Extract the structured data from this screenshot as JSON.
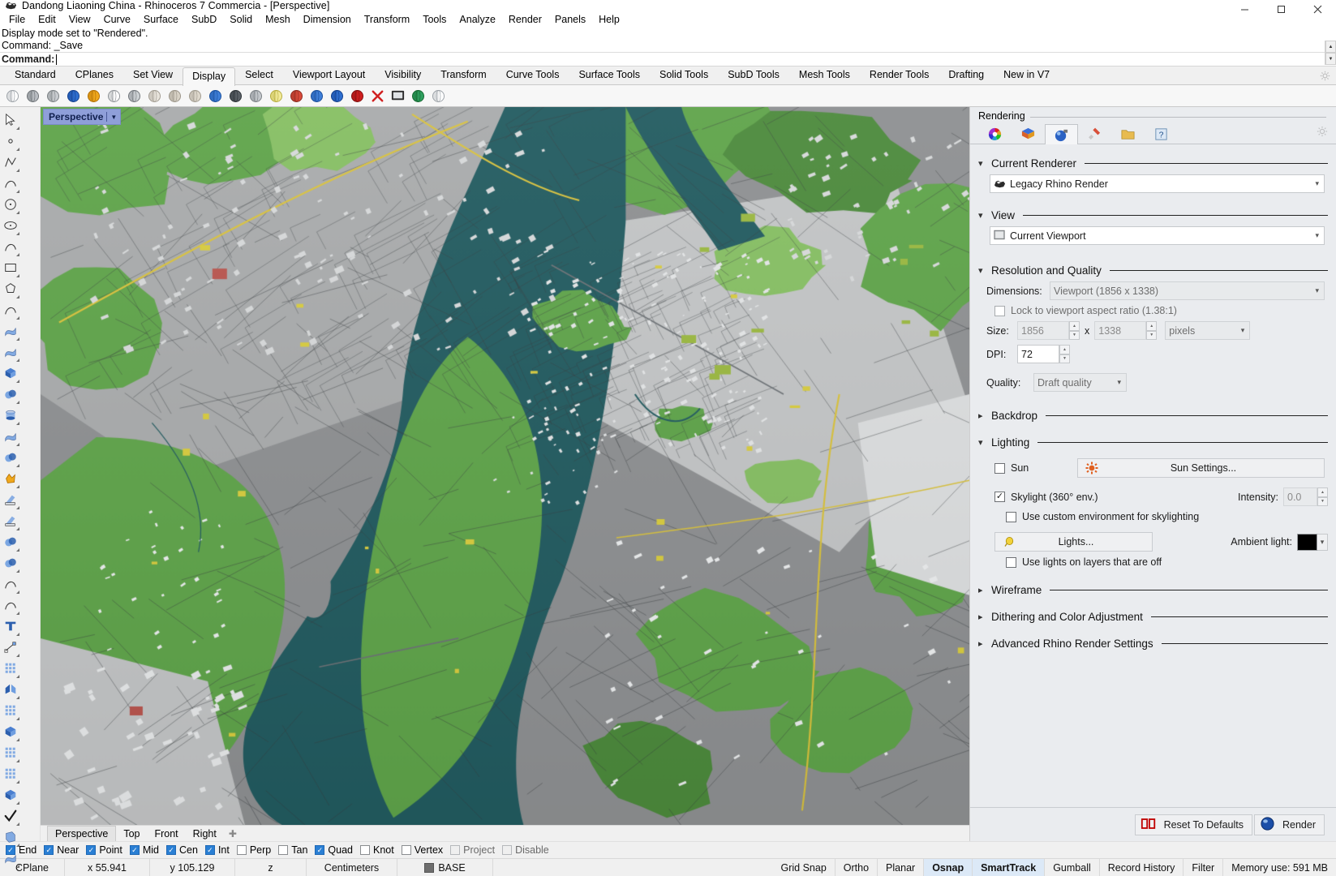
{
  "window": {
    "title": "Dandong Liaoning China - Rhinoceros 7 Commercia - [Perspective]",
    "app_icon": "rhino-icon",
    "minimize": "–",
    "maximize": "□",
    "close": "✕"
  },
  "menubar": {
    "items": [
      {
        "label": "File"
      },
      {
        "label": "Edit"
      },
      {
        "label": "View"
      },
      {
        "label": "Curve"
      },
      {
        "label": "Surface"
      },
      {
        "label": "SubD"
      },
      {
        "label": "Solid"
      },
      {
        "label": "Mesh"
      },
      {
        "label": "Dimension"
      },
      {
        "label": "Transform"
      },
      {
        "label": "Tools"
      },
      {
        "label": "Analyze"
      },
      {
        "label": "Render"
      },
      {
        "label": "Panels"
      },
      {
        "label": "Help"
      }
    ]
  },
  "command_history": {
    "lines": [
      "Display mode set to \"Rendered\".",
      "Command: _Save"
    ],
    "prompt_label": "Command:",
    "prompt_value": ""
  },
  "toolbar_tabs": {
    "items": [
      {
        "label": "Standard"
      },
      {
        "label": "CPlanes"
      },
      {
        "label": "Set View"
      },
      {
        "label": "Display"
      },
      {
        "label": "Select"
      },
      {
        "label": "Viewport Layout"
      },
      {
        "label": "Visibility"
      },
      {
        "label": "Transform"
      },
      {
        "label": "Curve Tools"
      },
      {
        "label": "Surface Tools"
      },
      {
        "label": "Solid Tools"
      },
      {
        "label": "SubD Tools"
      },
      {
        "label": "Mesh Tools"
      },
      {
        "label": "Render Tools"
      },
      {
        "label": "Drafting"
      },
      {
        "label": "New in V7"
      }
    ],
    "active": "Display"
  },
  "display_toolbar": {
    "icons": [
      "wireframe-display-icon",
      "shaded-display-icon",
      "shaded-ghosted-icon",
      "rendered-display-icon",
      "artistic-display-icon",
      "technical-display-icon",
      "pen-display-icon",
      "arctic-display-icon",
      "raytraced-display-icon",
      "monochrome-icon",
      "display-mode-options-icon",
      "shade-icon",
      "ghosted-view-icon",
      "xray-display-icon",
      "pearl-shade-icon",
      "color-backface-icon",
      "shadow-toggle-icon",
      "clipping-plane-icon",
      "delete-display-mode-icon",
      "fullscreen-icon",
      "isolate-icon",
      "color-picker-icon"
    ]
  },
  "left_toolbar": {
    "icons": [
      "select-arrow-icon",
      "point-object-icon",
      "polyline-icon",
      "curve-interpolate-icon",
      "circle-icon",
      "ellipse-icon",
      "arc-icon",
      "rectangle-icon",
      "polygon-icon",
      "curve-blend-icon",
      "surface-from-corners-icon",
      "surface-loft-icon",
      "box-icon",
      "sphere-icon",
      "cylinder-icon",
      "surface-planar-icon",
      "boolean-union-icon",
      "explode-icon",
      "trim-icon",
      "split-icon",
      "boolean-difference-icon",
      "boolean-intersection-icon",
      "fillet-curve-icon",
      "offset-curve-icon",
      "text-icon",
      "dimension-icon",
      "group-icon",
      "mirror-icon",
      "array-icon",
      "extrude-icon",
      "rectangular-array-icon",
      "polar-array-icon",
      "cap-icon",
      "check-object-icon",
      "shell-icon",
      "surface-flow-icon"
    ]
  },
  "viewport": {
    "title": "Perspective",
    "dropdown_arrow": "▼",
    "tabs": [
      {
        "label": "Perspective",
        "active": true
      },
      {
        "label": "Top",
        "active": false
      },
      {
        "label": "Front",
        "active": false
      },
      {
        "label": "Right",
        "active": false
      }
    ],
    "add_tab_icon": "add-viewport-icon",
    "scene_description": "Rendered 3D city map of Dandong, Liaoning, China with Yalu River",
    "colors": {
      "water": "#225b60",
      "land_gray": "#8e9092",
      "land_gray_light": "#a9abac",
      "land_gray_lighter": "#c3c5c6",
      "green": "#5fa44a",
      "green_dark": "#4c8a3c",
      "green_light": "#86bf63",
      "building_white": "#d7d9da",
      "road_yellow": "#d9c23c",
      "accent_red": "#b9554e",
      "accent_yellow": "#d8cc3e"
    }
  },
  "rendering_panel": {
    "header": "Rendering",
    "tabs": [
      {
        "icon": "color-wheel-icon",
        "active": false
      },
      {
        "icon": "materials-icon",
        "active": false
      },
      {
        "icon": "rendering-sphere-icon",
        "active": true
      },
      {
        "icon": "paintbrush-icon",
        "active": false
      },
      {
        "icon": "folder-icon",
        "active": false
      },
      {
        "icon": "help-icon",
        "active": false
      }
    ],
    "gear_icon": "gear-icon",
    "sections": {
      "current_renderer": {
        "title": "Current Renderer",
        "expanded": true,
        "value": "Legacy Rhino Render",
        "value_icon": "rhino-render-icon"
      },
      "view": {
        "title": "View",
        "expanded": true,
        "value": "Current Viewport",
        "value_icon": "viewport-icon"
      },
      "resolution_and_quality": {
        "title": "Resolution and Quality",
        "expanded": true,
        "dimensions_label": "Dimensions:",
        "dimensions_value": "Viewport (1856 x 1338)",
        "lock_aspect_label": "Lock to viewport aspect ratio (1.38:1)",
        "lock_aspect_checked": false,
        "size_label": "Size:",
        "size_width": "1856",
        "size_x": "x",
        "size_height": "1338",
        "size_units": "pixels",
        "dpi_label": "DPI:",
        "dpi_value": "72",
        "quality_label": "Quality:",
        "quality_value": "Draft quality"
      },
      "backdrop": {
        "title": "Backdrop",
        "expanded": false
      },
      "lighting": {
        "title": "Lighting",
        "expanded": true,
        "sun_label": "Sun",
        "sun_checked": false,
        "sun_settings_button": "Sun Settings...",
        "sun_icon": "sun-icon",
        "skylight_label": "Skylight (360° env.)",
        "skylight_checked": true,
        "intensity_label": "Intensity:",
        "intensity_value": "0.0",
        "custom_env_label": "Use custom environment for skylighting",
        "custom_env_checked": false,
        "lights_button": "Lights...",
        "lights_icon": "lightbulb-icon",
        "ambient_label": "Ambient light:",
        "ambient_color": "#000000",
        "lights_off_label": "Use lights on layers that are off",
        "lights_off_checked": false
      },
      "wireframe": {
        "title": "Wireframe",
        "expanded": false
      },
      "dithering": {
        "title": "Dithering and Color Adjustment",
        "expanded": false
      },
      "advanced": {
        "title": "Advanced Rhino Render Settings",
        "expanded": false
      }
    },
    "footer": {
      "reset_label": "Reset To Defaults",
      "reset_icon": "reset-00-icon",
      "render_label": "Render",
      "render_icon": "render-sphere-icon"
    }
  },
  "osnap_bar": {
    "items": [
      {
        "label": "End",
        "checked": true
      },
      {
        "label": "Near",
        "checked": true
      },
      {
        "label": "Point",
        "checked": true
      },
      {
        "label": "Mid",
        "checked": true
      },
      {
        "label": "Cen",
        "checked": true
      },
      {
        "label": "Int",
        "checked": true
      },
      {
        "label": "Perp",
        "checked": false
      },
      {
        "label": "Tan",
        "checked": false
      },
      {
        "label": "Quad",
        "checked": true
      },
      {
        "label": "Knot",
        "checked": false
      },
      {
        "label": "Vertex",
        "checked": false
      },
      {
        "label": "Project",
        "checked": false,
        "dim": true
      },
      {
        "label": "Disable",
        "checked": false,
        "dim": true
      }
    ]
  },
  "status_bar": {
    "cplane": "CPlane",
    "x": "x 55.941",
    "y": "y 105.129",
    "z": "z",
    "units": "Centimeters",
    "layer": "BASE",
    "layer_swatch": "#6e6e6e",
    "toggles": [
      {
        "label": "Grid Snap",
        "active": false
      },
      {
        "label": "Ortho",
        "active": false
      },
      {
        "label": "Planar",
        "active": false
      },
      {
        "label": "Osnap",
        "active": true
      },
      {
        "label": "SmartTrack",
        "active": true
      },
      {
        "label": "Gumball",
        "active": false
      },
      {
        "label": "Record History",
        "active": false
      },
      {
        "label": "Filter",
        "active": false
      }
    ],
    "memory": "Memory use: 591 MB"
  }
}
